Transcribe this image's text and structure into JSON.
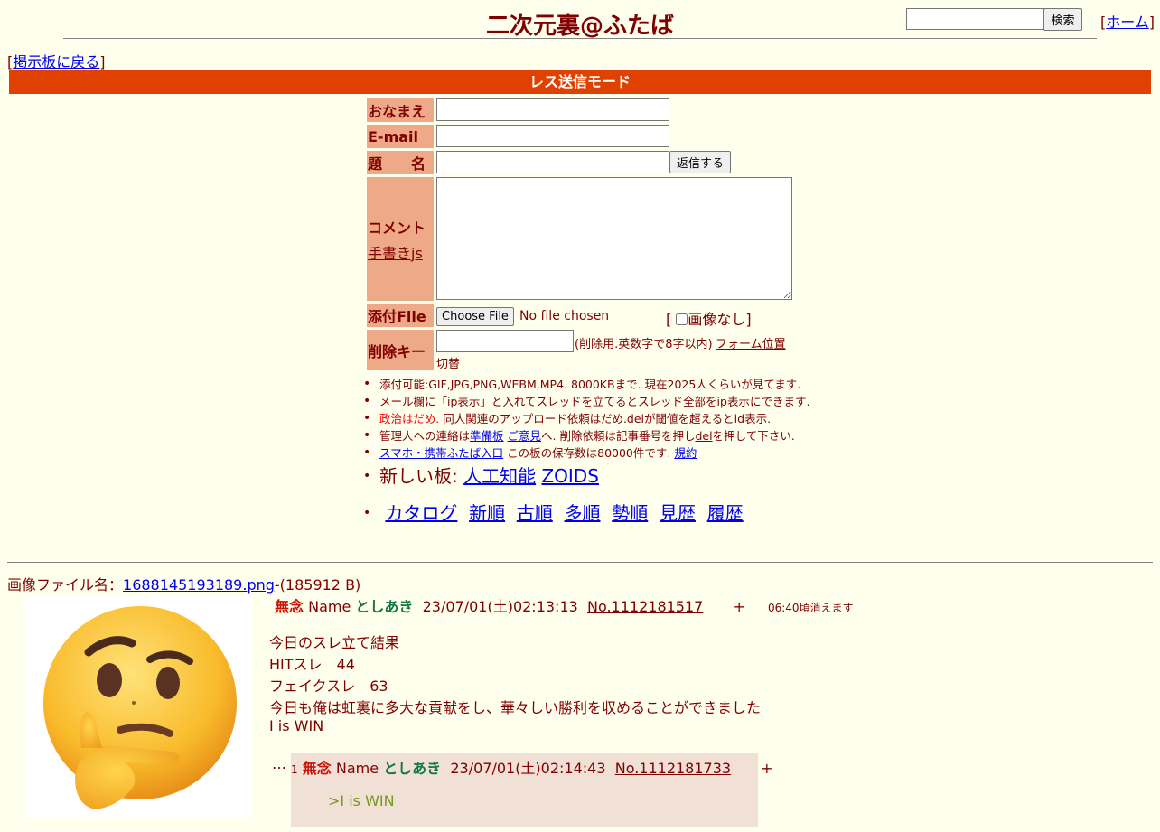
{
  "header": {
    "title": "二次元裏@ふたば",
    "search_button": "検索",
    "home_label": "ホーム",
    "back_label": "掲示板に戻る"
  },
  "mode_bar": "レス送信モード",
  "form": {
    "name_label": "おなまえ",
    "email_label": "E-mail",
    "subject_label": "題　　名",
    "submit_label": "返信する",
    "comment_label": "コメント",
    "handwrite_label": "手書きjs",
    "file_label": "添付File",
    "choose_file_label": "Choose File",
    "no_file_text": "No file chosen",
    "no_image_label": "画像なし",
    "delkey_label": "削除キー",
    "delkey_note": "(削除用.英数字で8字以内)",
    "form_pos_label": "フォーム位置",
    "form_pos_label2": "切替"
  },
  "notes": {
    "n1": "添付可能:GIF,JPG,PNG,WEBM,MP4. 8000KBまで. 現在2025人くらいが見てます.",
    "n2": "メール欄に「ip表示」と入れてスレッドを立てるとスレッド全部をip表示にできます.",
    "n3_red": "政治はだめ.",
    "n3_rest": " 同人関連のアップロード依頼はだめ.delが閾値を超えるとid表示.",
    "n4_a": "管理人への連絡は",
    "n4_link1": "準備板",
    "n4_link2": "ご意見",
    "n4_b": "へ. 削除依頼は記事番号を押し",
    "n4_del": "del",
    "n4_c": "を押して下さい.",
    "n5_link": "スマホ・携帯ふたば入口",
    "n5_text": " この板の保存数は80000件です.",
    "n5_rules": "規約",
    "new_boards_label": "新しい板:",
    "board1": "人工知能",
    "board2": "ZOIDS",
    "nav": [
      "カタログ",
      "新順",
      "古順",
      "多順",
      "勢順",
      "見歴",
      "履歴"
    ]
  },
  "post": {
    "file_label": "画像ファイル名：",
    "file_name": "1688145193189.png",
    "file_size": "-(185912 B)",
    "image_icon": "thinking-face-icon",
    "subject": "無念",
    "name_label": "Name",
    "name": "としあき",
    "date": "23/07/01(土)02:13:13",
    "number": "No.1112181517",
    "plus": "+",
    "expire": "06:40頃消えます",
    "body": [
      "今日のスレ立て結果",
      "HITスレ　44",
      "フェイクスレ　63",
      "今日も俺は虹裏に多大な貢献をし、華々しい勝利を収めることができました",
      "I is WIN"
    ]
  },
  "reply": {
    "dots": "…",
    "index": "1",
    "subject": "無念",
    "name_label": "Name",
    "name": "としあき",
    "date": "23/07/01(土)02:14:43",
    "number": "No.1112181733",
    "plus": "+",
    "quote": ">I is WIN"
  }
}
